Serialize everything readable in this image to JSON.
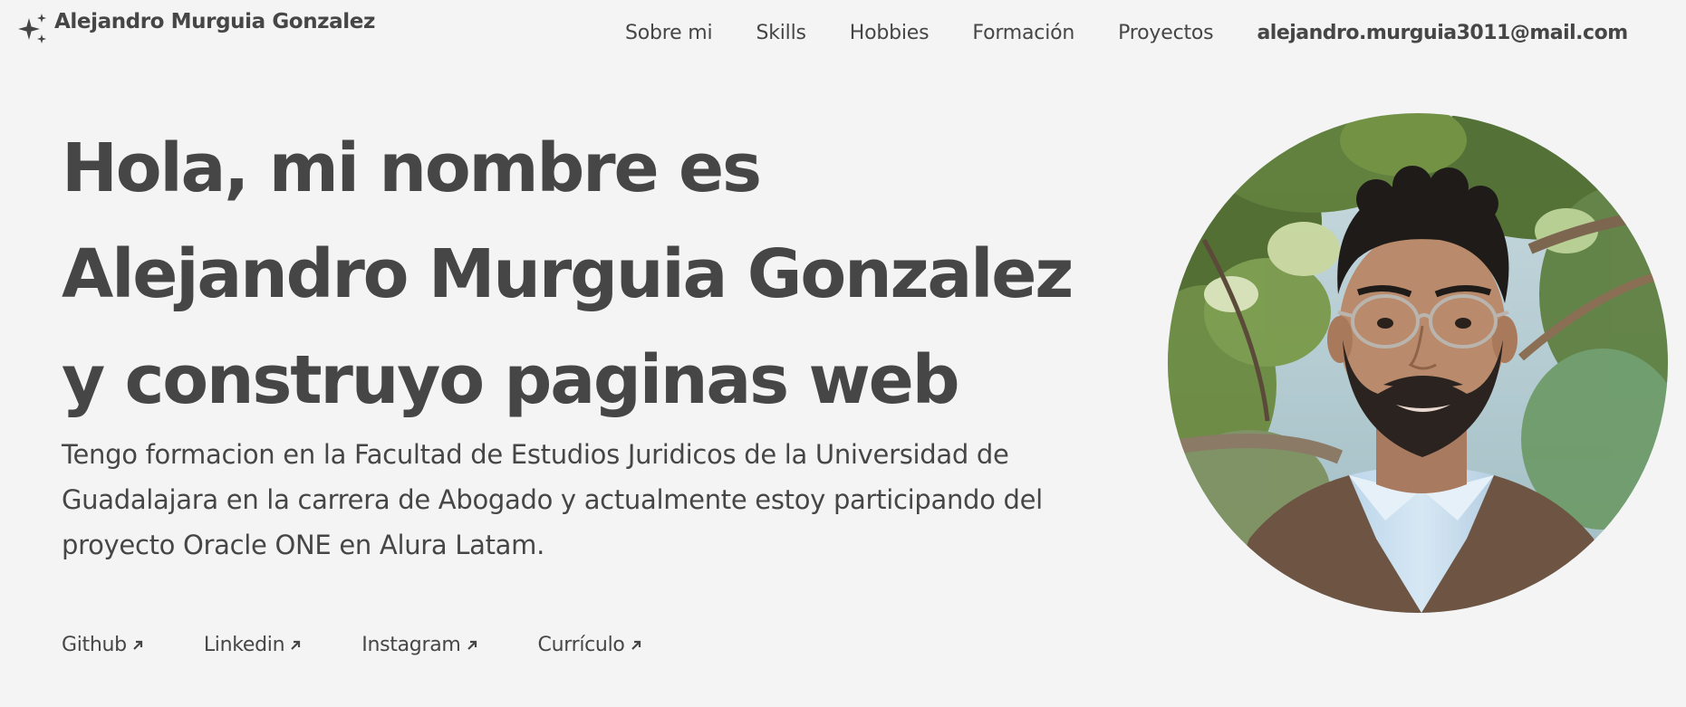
{
  "header": {
    "brand_name": "Alejandro Murguia Gonzalez",
    "brand_icon": "sparkles-icon",
    "nav": [
      {
        "label": "Sobre mi"
      },
      {
        "label": "Skills"
      },
      {
        "label": "Hobbies"
      },
      {
        "label": "Formación"
      },
      {
        "label": "Proyectos"
      }
    ],
    "email": "alejandro.murguia3011@mail.com"
  },
  "hero": {
    "title": "Hola, mi nombre es Alejandro Murguia Gonzalez y construyo paginas web",
    "description": "Tengo formacion en la Facultad de Estudios Juridicos de la Universidad de Guadalajara en la carrera de Abogado y actualmente estoy participando del proyecto Oracle ONE en Alura Latam.",
    "links": [
      {
        "label": "Github",
        "icon": "arrow-up-right-icon"
      },
      {
        "label": "Linkedin",
        "icon": "arrow-up-right-icon"
      },
      {
        "label": "Instagram",
        "icon": "arrow-up-right-icon"
      },
      {
        "label": "Currículo",
        "icon": "arrow-up-right-icon"
      }
    ]
  },
  "colors": {
    "background": "#f4f4f4",
    "text": "#464646"
  }
}
